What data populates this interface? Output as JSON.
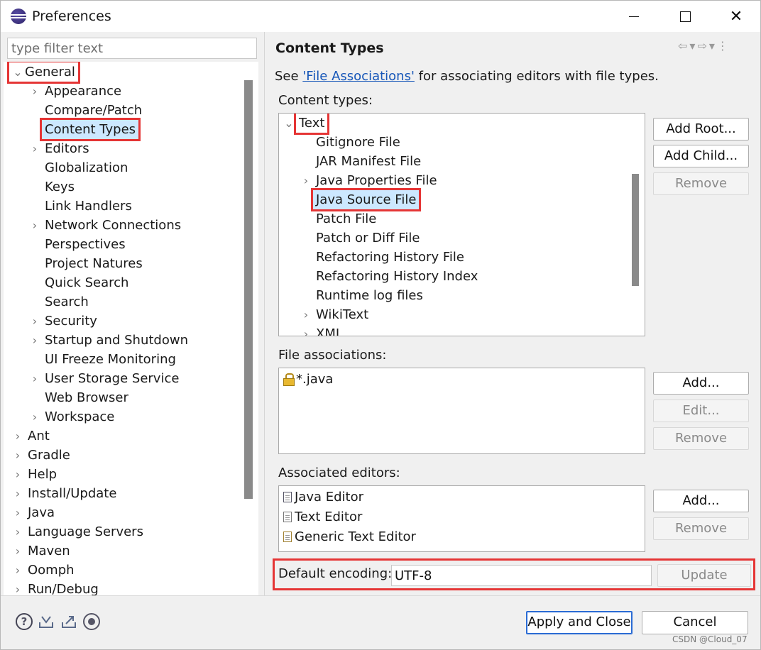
{
  "window": {
    "title": "Preferences",
    "controls": {
      "minimize": "",
      "maximize": "",
      "close": "✕"
    }
  },
  "left": {
    "filter_placeholder": "type filter text",
    "tree": [
      {
        "label": "General",
        "expanded": true,
        "level": 0,
        "highlighted": true
      },
      {
        "label": "Appearance",
        "level": 1,
        "expandable": true
      },
      {
        "label": "Compare/Patch",
        "level": 1
      },
      {
        "label": "Content Types",
        "level": 1,
        "selected": true,
        "highlighted": true
      },
      {
        "label": "Editors",
        "level": 1,
        "expandable": true
      },
      {
        "label": "Globalization",
        "level": 1
      },
      {
        "label": "Keys",
        "level": 1
      },
      {
        "label": "Link Handlers",
        "level": 1
      },
      {
        "label": "Network Connections",
        "level": 1,
        "expandable": true
      },
      {
        "label": "Perspectives",
        "level": 1
      },
      {
        "label": "Project Natures",
        "level": 1
      },
      {
        "label": "Quick Search",
        "level": 1
      },
      {
        "label": "Search",
        "level": 1
      },
      {
        "label": "Security",
        "level": 1,
        "expandable": true
      },
      {
        "label": "Startup and Shutdown",
        "level": 1,
        "expandable": true
      },
      {
        "label": "UI Freeze Monitoring",
        "level": 1
      },
      {
        "label": "User Storage Service",
        "level": 1,
        "expandable": true
      },
      {
        "label": "Web Browser",
        "level": 1
      },
      {
        "label": "Workspace",
        "level": 1,
        "expandable": true
      },
      {
        "label": "Ant",
        "level": 0,
        "expandable": true
      },
      {
        "label": "Gradle",
        "level": 0,
        "expandable": true
      },
      {
        "label": "Help",
        "level": 0,
        "expandable": true
      },
      {
        "label": "Install/Update",
        "level": 0,
        "expandable": true
      },
      {
        "label": "Java",
        "level": 0,
        "expandable": true
      },
      {
        "label": "Language Servers",
        "level": 0,
        "expandable": true
      },
      {
        "label": "Maven",
        "level": 0,
        "expandable": true
      },
      {
        "label": "Oomph",
        "level": 0,
        "expandable": true
      },
      {
        "label": "Run/Debug",
        "level": 0,
        "expandable": true
      }
    ]
  },
  "page": {
    "title": "Content Types",
    "see_prefix": "See ",
    "see_link": "'File Associations'",
    "see_suffix": " for associating editors with file types.",
    "content_types_label": "Content types:",
    "content_types": [
      {
        "label": "Text",
        "level": 0,
        "expanded": true,
        "highlighted": true
      },
      {
        "label": "Gitignore File",
        "level": 1
      },
      {
        "label": "JAR Manifest File",
        "level": 1
      },
      {
        "label": "Java Properties File",
        "level": 1,
        "expandable": true
      },
      {
        "label": "Java Source File",
        "level": 1,
        "selected": true,
        "highlighted": true
      },
      {
        "label": "Patch File",
        "level": 1
      },
      {
        "label": "Patch or Diff File",
        "level": 1
      },
      {
        "label": "Refactoring History File",
        "level": 1
      },
      {
        "label": "Refactoring History Index",
        "level": 1
      },
      {
        "label": "Runtime log files",
        "level": 1
      },
      {
        "label": "WikiText",
        "level": 1,
        "expandable": true
      },
      {
        "label": "XML",
        "level": 1,
        "expandable": true
      }
    ],
    "content_type_buttons": {
      "add_root": "Add Root...",
      "add_child": "Add Child...",
      "remove": "Remove"
    },
    "file_assoc_label": "File associations:",
    "file_associations": [
      {
        "label": "*.java",
        "icon": "lock-icon"
      }
    ],
    "file_assoc_buttons": {
      "add": "Add...",
      "edit": "Edit...",
      "remove": "Remove"
    },
    "editors_label": "Associated editors:",
    "editors": [
      {
        "label": "Java Editor",
        "icon": "java-editor-icon"
      },
      {
        "label": "Text Editor",
        "icon": "text-editor-icon"
      },
      {
        "label": "Generic Text Editor",
        "icon": "generic-editor-icon"
      }
    ],
    "editor_buttons": {
      "add": "Add...",
      "remove": "Remove"
    },
    "encoding_label": "Default encoding:",
    "encoding_value": "UTF-8",
    "update_button": "Update"
  },
  "footer": {
    "help_glyph": "?",
    "apply_close": "Apply and Close",
    "cancel": "Cancel"
  },
  "watermark": "CSDN @Cloud_07",
  "colors": {
    "highlight": "#e53535",
    "selection": "#cce8ff",
    "link": "#1656b8"
  }
}
